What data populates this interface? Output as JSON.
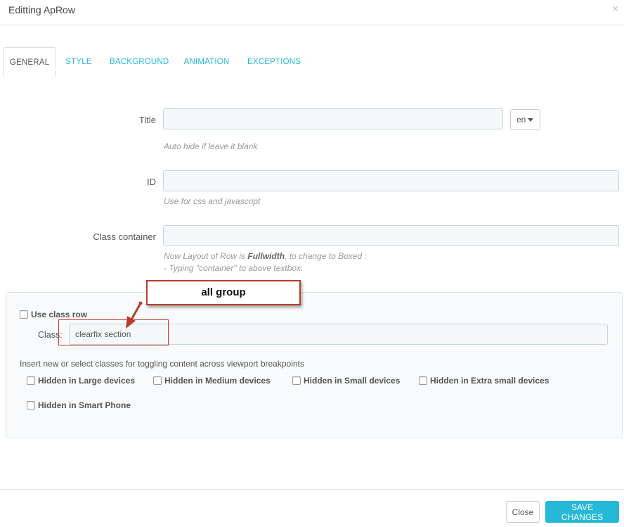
{
  "modal": {
    "title": "Editting ApRow",
    "close_glyph": "×"
  },
  "tabs": [
    {
      "label": "GENERAL",
      "active": true
    },
    {
      "label": "STYLE"
    },
    {
      "label": "BACKGROUND"
    },
    {
      "label": "ANIMATION"
    },
    {
      "label": "EXCEPTIONS"
    }
  ],
  "form": {
    "title": {
      "label": "Title",
      "value": "",
      "lang": "en",
      "help": "Auto hide if leave it blank"
    },
    "id": {
      "label": "ID",
      "value": "",
      "help": "Use for css and javascript"
    },
    "class_container": {
      "label": "Class container",
      "value": "",
      "help_prefix": "Now Layout of Row is ",
      "help_bold": "Fullwidth",
      "help_suffix": ", to change to Boxed :",
      "help_line2": "- Typing \"container\" to above textbox."
    }
  },
  "panel": {
    "use_class_row": "Use class row",
    "class_label": "Class:",
    "class_value": "clearfix section",
    "instruction": "Insert new or select classes for toggling content across viewport breakpoints",
    "checkboxes": [
      "Hidden in Large devices",
      "Hidden in Medium devices",
      "Hidden in Small devices",
      "Hidden in Extra small devices",
      "Hidden in Smart Phone"
    ]
  },
  "annotation": {
    "callout_text": "all group",
    "color": "#b83d2a"
  },
  "footer": {
    "close_label": "Close",
    "save_label": "SAVE CHANGES"
  },
  "colors": {
    "accent": "#25b9d7",
    "input_bg": "#f5f8f9",
    "panel_bg": "#f8fafb"
  },
  "icons": {
    "lang_caret": "caret-down-icon",
    "close": "close-icon"
  }
}
